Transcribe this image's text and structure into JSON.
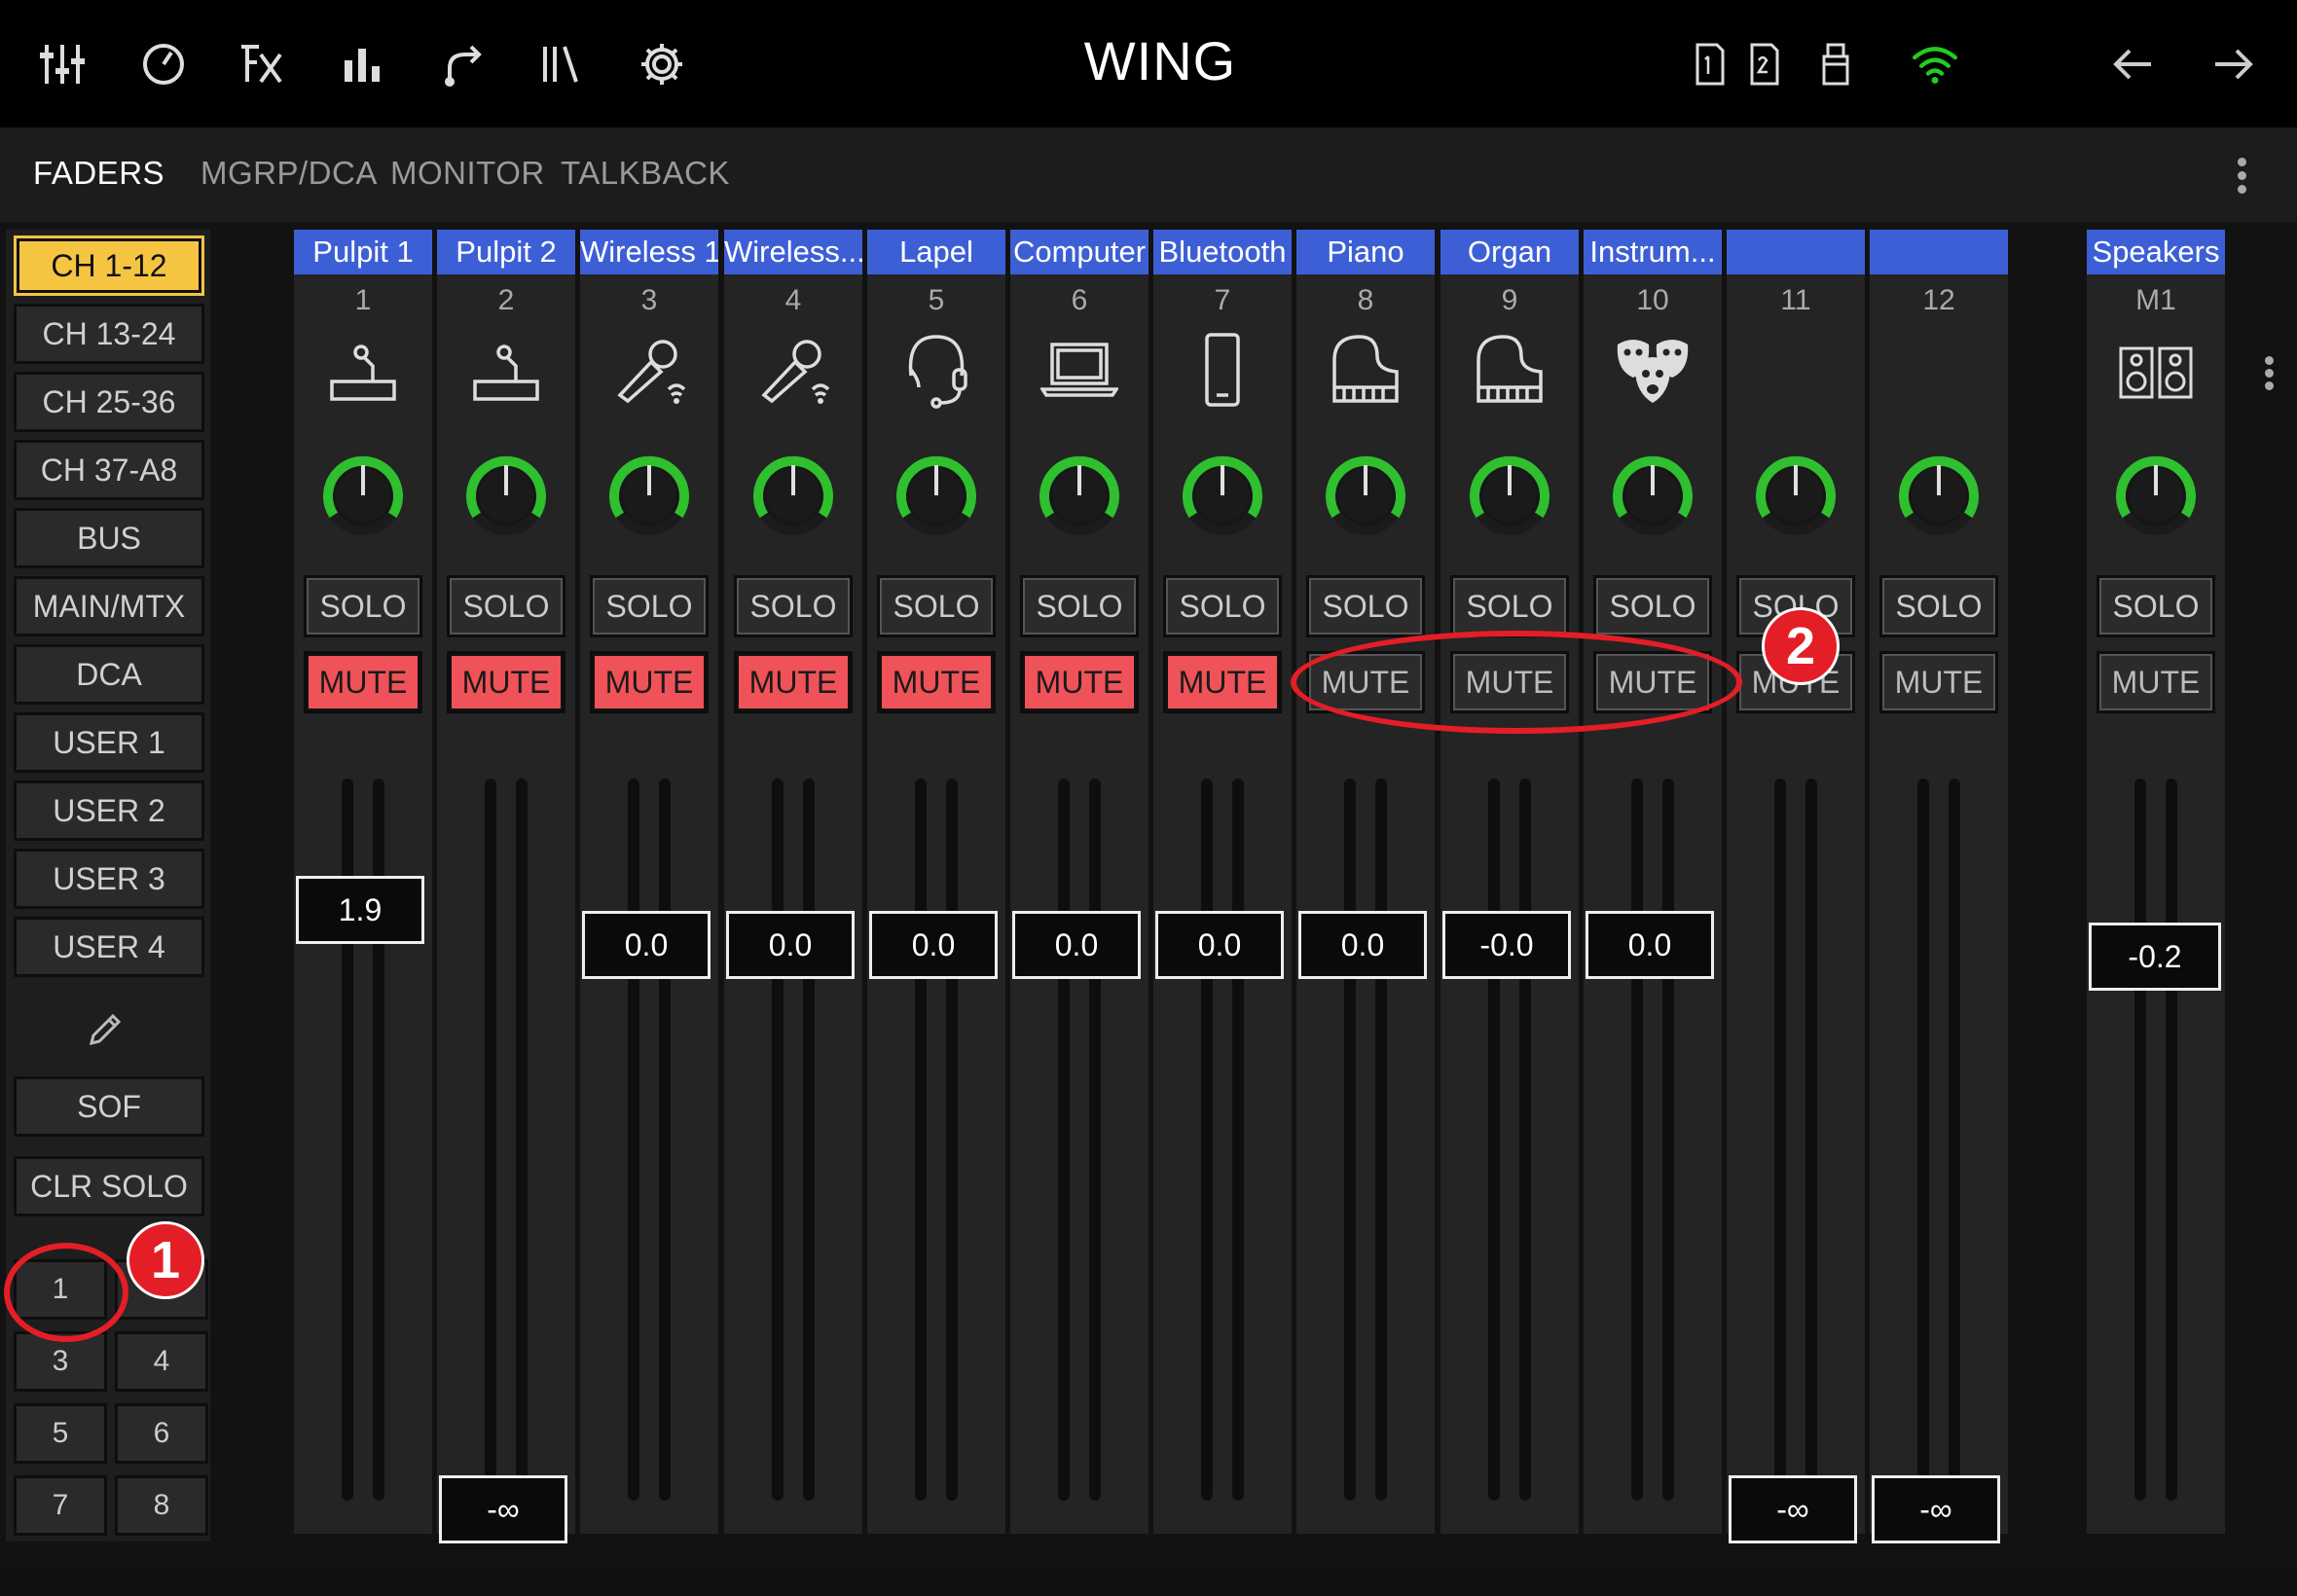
{
  "app": {
    "title": "WING"
  },
  "tabs": [
    {
      "label": "FADERS",
      "active": true
    },
    {
      "label": "MGRP/DCA",
      "active": false
    },
    {
      "label": "MONITOR",
      "active": false
    },
    {
      "label": "TALKBACK",
      "active": false
    }
  ],
  "topbar_icons": [
    "mixer-sliders-icon",
    "meter-dial-icon",
    "fx-icon",
    "bar-chart-icon",
    "routing-icon",
    "library-icon",
    "gear-icon",
    "sd-card-1-icon",
    "sd-card-2-icon",
    "usb-drive-icon",
    "wifi-icon",
    "back-arrow-icon",
    "forward-arrow-icon"
  ],
  "sidebar": {
    "items": [
      "CH 1-12",
      "CH 13-24",
      "CH 25-36",
      "CH 37-A8",
      "BUS",
      "MAIN/MTX",
      "DCA",
      "USER 1",
      "USER 2",
      "USER 3",
      "USER 4"
    ],
    "active": "CH 1-12",
    "sof_label": "SOF",
    "clr_solo_label": "CLR SOLO",
    "edit_icon": "pencil-icon",
    "number_buttons": [
      "1",
      "2",
      "3",
      "4",
      "5",
      "6",
      "7",
      "8"
    ]
  },
  "strip_labels": {
    "solo": "SOLO",
    "mute": "MUTE"
  },
  "channels": [
    {
      "name": "Pulpit 1",
      "number": "1",
      "icon": "podium-mic-icon",
      "muted": true,
      "fader": "1.9"
    },
    {
      "name": "Pulpit 2",
      "number": "2",
      "icon": "podium-mic-icon",
      "muted": true,
      "fader": "-∞"
    },
    {
      "name": "Wireless 1",
      "number": "3",
      "icon": "wireless-mic-icon",
      "muted": true,
      "fader": "0.0"
    },
    {
      "name": "Wireless...",
      "number": "4",
      "icon": "wireless-mic-icon",
      "muted": true,
      "fader": "0.0"
    },
    {
      "name": "Lapel",
      "number": "5",
      "icon": "headset-mic-icon",
      "muted": true,
      "fader": "0.0"
    },
    {
      "name": "Computer",
      "number": "6",
      "icon": "laptop-icon",
      "muted": true,
      "fader": "0.0"
    },
    {
      "name": "Bluetooth",
      "number": "7",
      "icon": "phone-icon",
      "muted": true,
      "fader": "0.0"
    },
    {
      "name": "Piano",
      "number": "8",
      "icon": "piano-icon",
      "muted": false,
      "fader": "0.0"
    },
    {
      "name": "Organ",
      "number": "9",
      "icon": "piano-icon",
      "muted": false,
      "fader": "-0.0"
    },
    {
      "name": "Instrum...",
      "number": "10",
      "icon": "drama-masks-icon",
      "muted": false,
      "fader": "0.0"
    },
    {
      "name": "",
      "number": "11",
      "icon": "",
      "muted": false,
      "fader": "-∞"
    },
    {
      "name": "",
      "number": "12",
      "icon": "",
      "muted": false,
      "fader": "-∞"
    }
  ],
  "main_strip": {
    "name": "Speakers",
    "number": "M1",
    "icon": "speakers-icon",
    "muted": false,
    "fader": "-0.2"
  },
  "annotations": [
    {
      "label": "1"
    },
    {
      "label": "2"
    }
  ],
  "colors": {
    "active_tab_yellow": "#f5c542",
    "mute_red": "#ef5258",
    "name_blue": "#3d5fd6",
    "knob_green": "#2fbf2f",
    "wifi_green": "#22cc22",
    "annotation_red": "#e41e26"
  }
}
